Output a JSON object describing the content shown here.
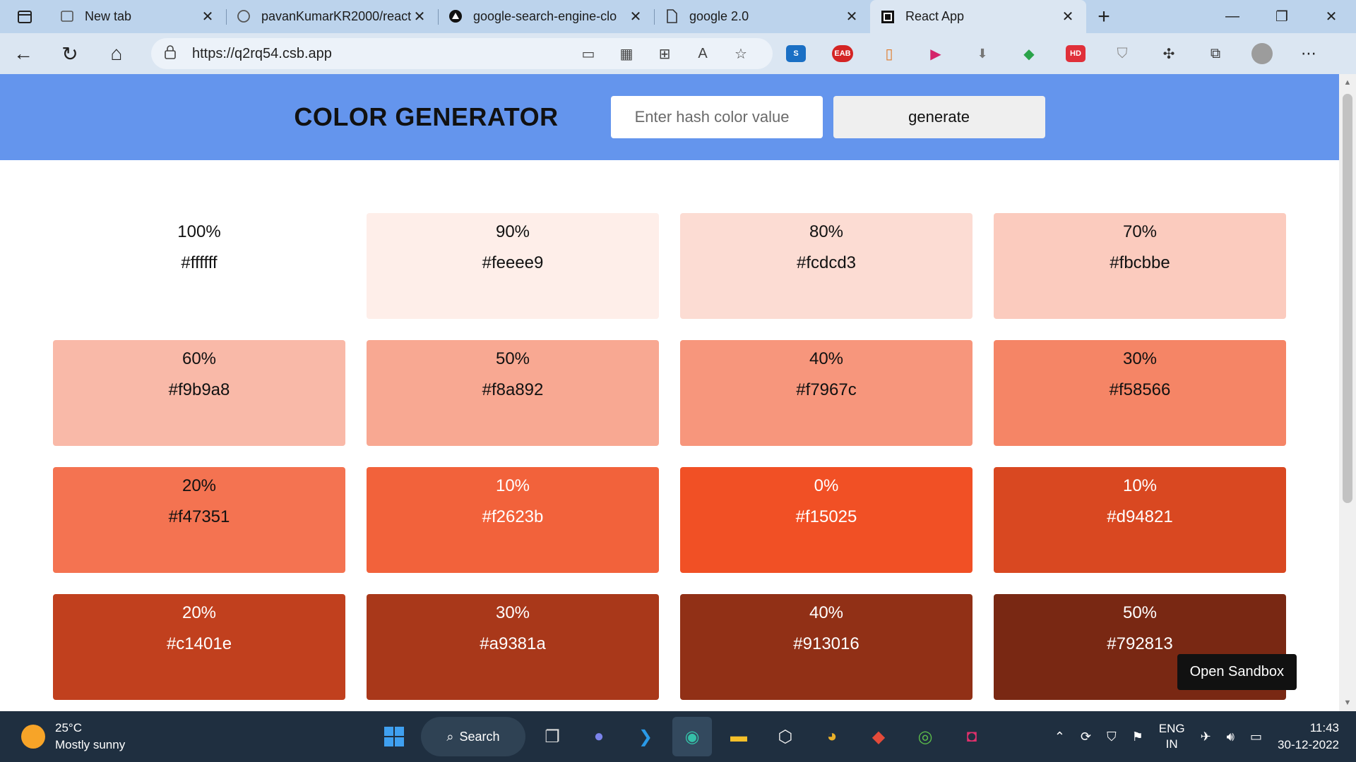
{
  "browser": {
    "tabs": [
      {
        "title": "New tab",
        "icon": "page-icon"
      },
      {
        "title": "pavanKumarKR2000/react",
        "icon": "github-icon"
      },
      {
        "title": "google-search-engine-clo",
        "icon": "triangle-icon"
      },
      {
        "title": "google 2.0",
        "icon": "document-icon"
      },
      {
        "title": "React App",
        "icon": "react-app-icon"
      }
    ],
    "url": "https://q2rq54.csb.app",
    "extensions": [
      "S",
      "EAB",
      "HD"
    ]
  },
  "app": {
    "title": "COLOR GENERATOR",
    "input_placeholder": "Enter hash color value",
    "generate_label": "generate",
    "open_sandbox": "Open Sandbox"
  },
  "swatches": [
    {
      "pct": "100%",
      "hex": "#ffffff",
      "bg": "#ffffff",
      "fg": "#111111"
    },
    {
      "pct": "90%",
      "hex": "#feeee9",
      "bg": "#feeee9",
      "fg": "#111111"
    },
    {
      "pct": "80%",
      "hex": "#fcdcd3",
      "bg": "#fcdcd3",
      "fg": "#111111"
    },
    {
      "pct": "70%",
      "hex": "#fbcbbe",
      "bg": "#fbcbbe",
      "fg": "#111111"
    },
    {
      "pct": "60%",
      "hex": "#f9b9a8",
      "bg": "#f9b9a8",
      "fg": "#111111"
    },
    {
      "pct": "50%",
      "hex": "#f8a892",
      "bg": "#f8a892",
      "fg": "#111111"
    },
    {
      "pct": "40%",
      "hex": "#f7967c",
      "bg": "#f7967c",
      "fg": "#111111"
    },
    {
      "pct": "30%",
      "hex": "#f58566",
      "bg": "#f58566",
      "fg": "#111111"
    },
    {
      "pct": "20%",
      "hex": "#f47351",
      "bg": "#f47351",
      "fg": "#111111"
    },
    {
      "pct": "10%",
      "hex": "#f2623b",
      "bg": "#f2623b",
      "fg": "#ffffff"
    },
    {
      "pct": "0%",
      "hex": "#f15025",
      "bg": "#f15025",
      "fg": "#ffffff"
    },
    {
      "pct": "10%",
      "hex": "#d94821",
      "bg": "#d94821",
      "fg": "#ffffff"
    },
    {
      "pct": "20%",
      "hex": "#c1401e",
      "bg": "#c1401e",
      "fg": "#ffffff"
    },
    {
      "pct": "30%",
      "hex": "#a9381a",
      "bg": "#a9381a",
      "fg": "#ffffff"
    },
    {
      "pct": "40%",
      "hex": "#913016",
      "bg": "#913016",
      "fg": "#ffffff"
    },
    {
      "pct": "50%",
      "hex": "#792813",
      "bg": "#792813",
      "fg": "#ffffff"
    }
  ],
  "taskbar": {
    "temperature": "25°C",
    "weather": "Mostly sunny",
    "search_label": "Search",
    "lang_top": "ENG",
    "lang_bottom": "IN",
    "time": "11:43",
    "date": "30-12-2022"
  }
}
